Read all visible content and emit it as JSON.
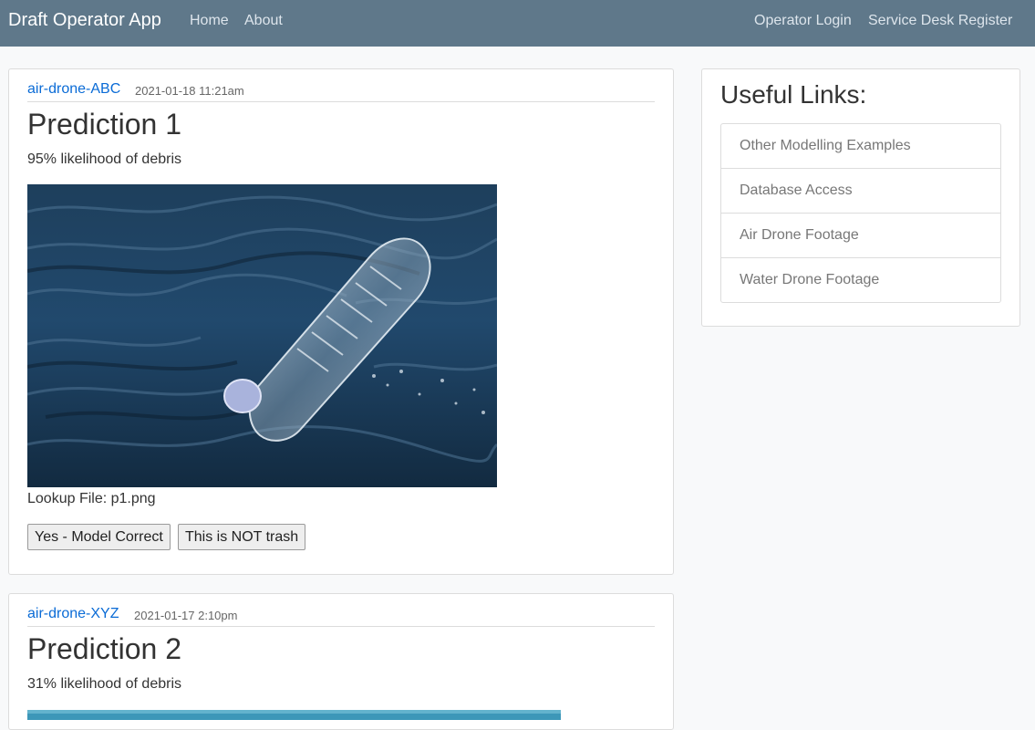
{
  "navbar": {
    "brand": "Draft Operator App",
    "links": [
      "Home",
      "About"
    ],
    "right_links": [
      "Operator Login",
      "Service Desk Register"
    ]
  },
  "posts": [
    {
      "author": "air-drone-ABC",
      "date": "2021-01-18 11:21am",
      "title": "Prediction 1",
      "likelihood": "95% likelihood of debris",
      "lookup": "Lookup File: p1.png",
      "buttons": [
        "Yes - Model Correct",
        "This is NOT trash"
      ]
    },
    {
      "author": "air-drone-XYZ",
      "date": "2021-01-17 2:10pm",
      "title": "Prediction 2",
      "likelihood": "31% likelihood of debris"
    }
  ],
  "sidebar": {
    "title": "Useful Links:",
    "items": [
      "Other Modelling Examples",
      "Database Access",
      "Air Drone Footage",
      "Water Drone Footage"
    ]
  }
}
